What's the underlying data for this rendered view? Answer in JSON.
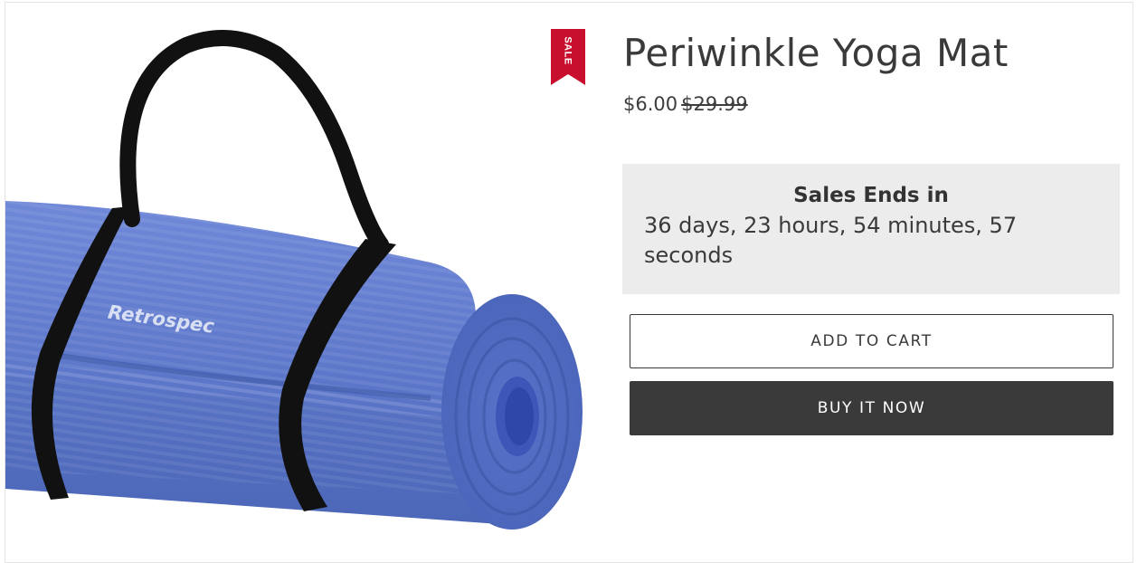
{
  "product": {
    "title": "Periwinkle Yoga Mat",
    "price": "$6.00",
    "compare_price": "$29.99",
    "image_brand_text": "Retrospec",
    "image_icon": "rolled-yoga-mat-image"
  },
  "sale_badge": {
    "label": "SALE",
    "color": "#c8102e"
  },
  "countdown": {
    "heading": "Sales Ends in",
    "value": "36 days, 23 hours, 54 minutes, 57 seconds"
  },
  "actions": {
    "add_to_cart_label": "ADD TO CART",
    "buy_now_label": "BUY IT NOW"
  },
  "colors": {
    "mat": "#5b78c9",
    "strap": "#111111",
    "button_dark": "#3a3a3a",
    "countdown_bg": "#ececec"
  }
}
